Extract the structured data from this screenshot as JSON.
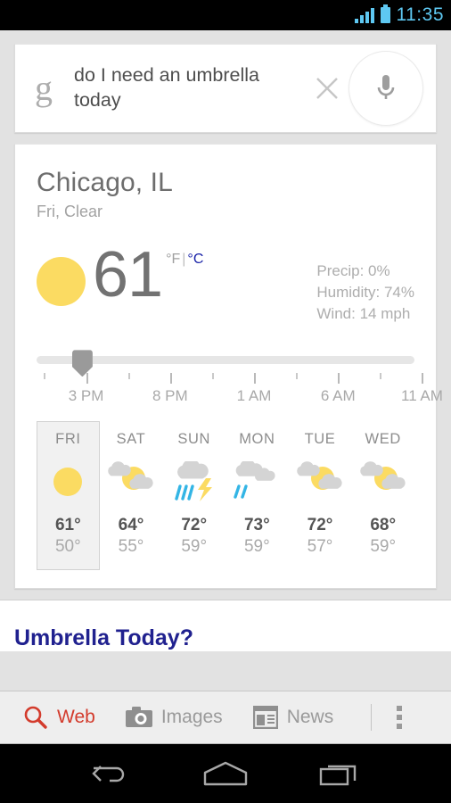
{
  "statusbar": {
    "time": "11:35",
    "signal_icon": "signal-bars-icon",
    "battery_icon": "battery-icon"
  },
  "search": {
    "logo": "g",
    "query": "do I need an umbrella today",
    "clear_icon": "close-icon",
    "mic_icon": "microphone-icon"
  },
  "weather": {
    "city": "Chicago, IL",
    "condition": "Fri, Clear",
    "current_icon": "sun-icon",
    "temperature": "61",
    "unit_f": "°F",
    "unit_separator": "|",
    "unit_c": "°C",
    "details": {
      "precip": "Precip: 0%",
      "humidity": "Humidity: 74%",
      "wind": "Wind: 14 mph"
    },
    "timeline": {
      "labels": [
        "3 PM",
        "8 PM",
        "1 AM",
        "6 AM",
        "11 AM"
      ],
      "handle_position_pct": 12
    },
    "forecast": [
      {
        "day": "FRI",
        "icon": "sun-icon",
        "high": "61°",
        "low": "50°",
        "selected": true
      },
      {
        "day": "SAT",
        "icon": "partly-cloudy-icon",
        "high": "64°",
        "low": "55°",
        "selected": false
      },
      {
        "day": "SUN",
        "icon": "thunderstorm-icon",
        "high": "72°",
        "low": "59°",
        "selected": false
      },
      {
        "day": "MON",
        "icon": "rain-icon",
        "high": "73°",
        "low": "59°",
        "selected": false
      },
      {
        "day": "TUE",
        "icon": "partly-cloudy-icon",
        "high": "72°",
        "low": "57°",
        "selected": false
      },
      {
        "day": "WED",
        "icon": "partly-cloudy-icon",
        "high": "68°",
        "low": "59°",
        "selected": false
      }
    ]
  },
  "result": {
    "title": "Umbrella Today?"
  },
  "tabs": [
    {
      "label": "Web",
      "icon": "search-magnifier-icon",
      "active": true
    },
    {
      "label": "Images",
      "icon": "camera-icon",
      "active": false
    },
    {
      "label": "News",
      "icon": "newspaper-icon",
      "active": false
    }
  ],
  "overflow_menu": {
    "icon": "more-vertical-icon"
  },
  "navbar": {
    "back": "back-arrow-icon",
    "home": "home-icon",
    "recents": "recent-apps-icon"
  },
  "colors": {
    "accent_red": "#d33b2c",
    "link_blue": "#20218f",
    "status_blue": "#5ec8f2",
    "sun_yellow": "#fbdb62",
    "cloud_gray": "#d4d4d4",
    "rain_blue": "#33b5e5"
  }
}
